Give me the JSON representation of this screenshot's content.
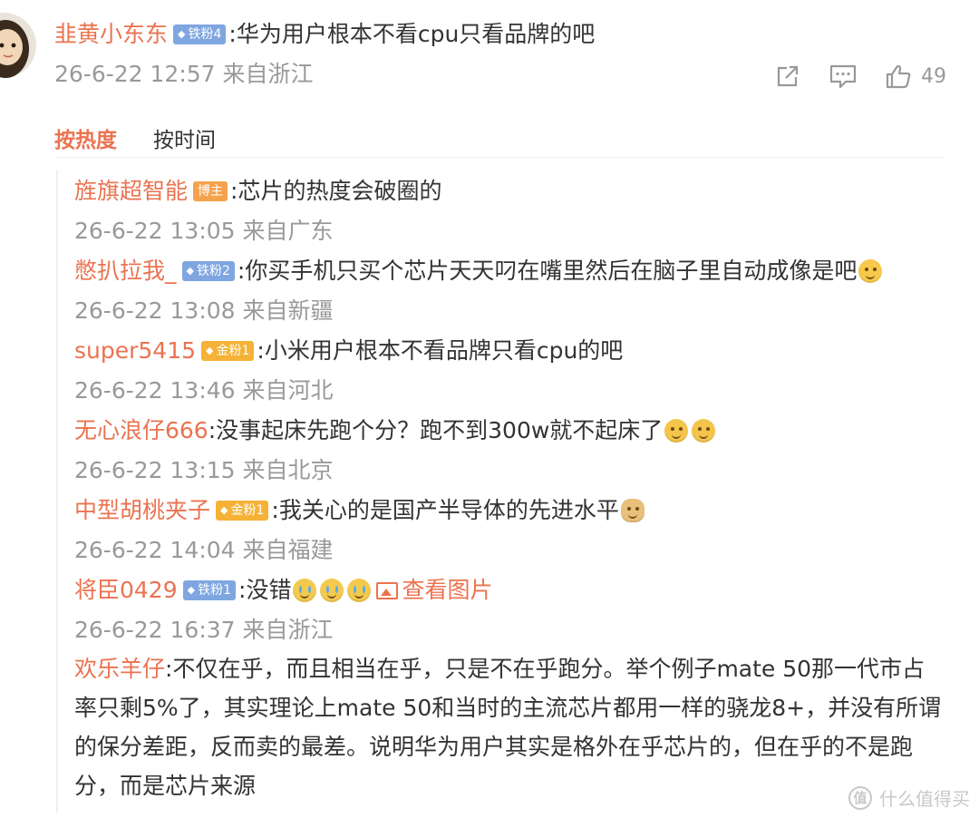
{
  "main_comment": {
    "username": "韭黄小东东",
    "badge": "铁粉4",
    "text": ":华为用户根本不看cpu只看品牌的吧",
    "time": "26-6-22 12:57 来自浙江",
    "like_count": "49"
  },
  "sort_tabs": {
    "hot": "按热度",
    "time": "按时间"
  },
  "replies": [
    {
      "username": "旌旗超智能",
      "badge": "博主",
      "badge_type": "blogger",
      "text": ":芯片的热度会破圈的",
      "time": "26-6-22 13:05 来自广东"
    },
    {
      "username": "憋扒拉我_",
      "badge": "铁粉2",
      "badge_type": "iron",
      "text": ":你买手机只买个芯片天天叼在嘴里然后在脑子里自动成像是吧",
      "time": "26-6-22 13:08 来自新疆"
    },
    {
      "username": "super5415",
      "badge": "金粉1",
      "badge_type": "gold",
      "text": ":小米用户根本不看品牌只看cpu的吧",
      "time": "26-6-22 13:46 来自河北"
    },
    {
      "username": "无心浪仔666",
      "text": ":没事起床先跑个分？跑不到300w就不起床了",
      "time": "26-6-22 13:15 来自北京"
    },
    {
      "username": "中型胡桃夹子",
      "badge": "金粉1",
      "badge_type": "gold",
      "text": ":我关心的是国产半导体的先进水平",
      "time": "26-6-22 14:04 来自福建"
    },
    {
      "username": "将臣0429",
      "badge": "铁粉1",
      "badge_type": "iron",
      "text": ":没错",
      "link": "查看图片",
      "time": "26-6-22 16:37 来自浙江"
    }
  ],
  "last_reply": {
    "username": "欢乐羊仔",
    "text": ":不仅在乎，而且相当在乎，只是不在乎跑分。举个例子mate 50那一代市占率只剩5%了，其实理论上mate 50和当时的主流芯片都用一样的骁龙8+，并没有所谓的保分差距，反而卖的最差。说明华为用户其实是格外在乎芯片的，但在乎的不是跑分，而是芯片来源"
  },
  "watermark": {
    "icon": "值",
    "text": "什么值得买"
  },
  "colors": {
    "accent": "#eb7350",
    "meta": "#999999",
    "iron_badge": "#7fa6e0",
    "gold_badge": "#f5b236"
  }
}
